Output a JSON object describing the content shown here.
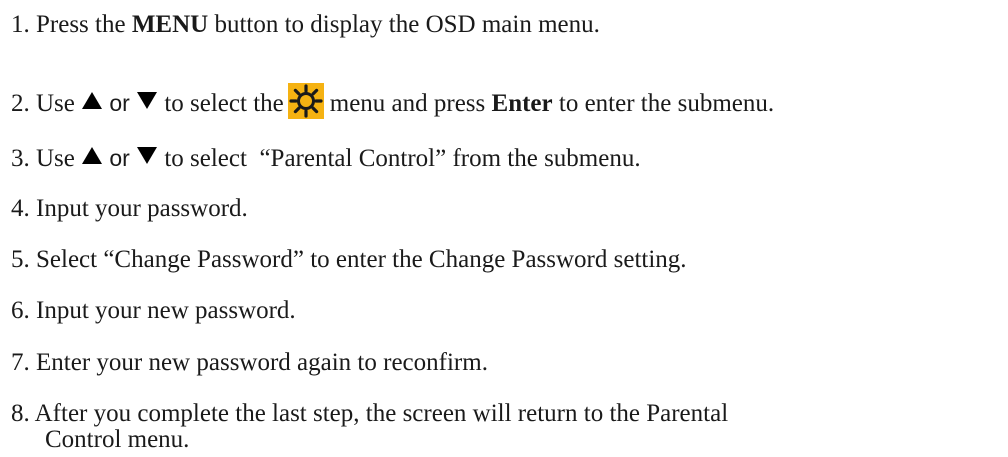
{
  "steps": [
    {
      "num": "1.",
      "pre": "Press the",
      "bold": "MENU",
      "post": "button to display the OSD main menu."
    },
    {
      "num": "2.",
      "pre": "Use",
      "or": "or",
      "mid": "to select the",
      "mid2": "menu and press",
      "bold": "Enter",
      "post": "to enter the submenu.",
      "icon": "sun-settings-icon"
    },
    {
      "num": "3.",
      "pre": "Use",
      "or": "or",
      "post": "to select  “Parental Control” from the submenu."
    },
    {
      "num": "4.",
      "text": "Input your password."
    },
    {
      "num": "5.",
      "text": "Select “Change Password” to enter the Change Password setting."
    },
    {
      "num": "6.",
      "text": "Input your new password."
    },
    {
      "num": "7.",
      "text": "Enter your new password again to reconfirm."
    },
    {
      "num": "8.",
      "text": "After you complete the last step, the screen will return to the Parental",
      "text2": "Control menu."
    }
  ],
  "icons": {
    "up": "up-triangle-icon",
    "down": "down-triangle-icon"
  },
  "colors": {
    "icon_bg": "#f5b212",
    "text": "#1a1a1a"
  }
}
